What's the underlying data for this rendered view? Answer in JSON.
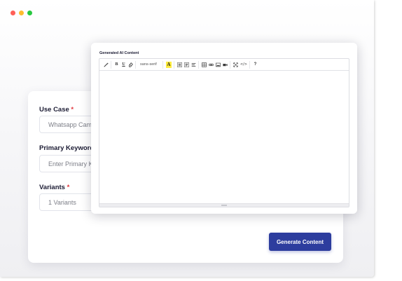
{
  "window": {
    "controls": [
      {
        "name": "close",
        "color": "#ff5f57"
      },
      {
        "name": "minimize",
        "color": "#febc2e"
      },
      {
        "name": "maximize",
        "color": "#28c840"
      }
    ]
  },
  "form": {
    "use_case": {
      "label": "Use Case",
      "required_mark": "*",
      "value": "Whatsapp Campaign"
    },
    "primary_keyword": {
      "label": "Primary Keyword",
      "placeholder": "Enter Primary Keyword"
    },
    "variants": {
      "label": "Variants",
      "required_mark": "*",
      "value": "1 Variants"
    },
    "generate_button": "Generate Content"
  },
  "editor": {
    "title": "Generated AI Content",
    "toolbar": {
      "magic_icon": "magic-wand-icon",
      "bold": "B",
      "underline": "U",
      "clear_icon": "eraser-icon",
      "font_family": "sans-serif",
      "color_letter": "A",
      "list_icons": [
        "unordered-list-icon",
        "ordered-list-icon",
        "align-icon"
      ],
      "insert_icons": [
        "table-icon",
        "link-icon",
        "image-icon",
        "video-icon"
      ],
      "view_icons": [
        "fullscreen-icon",
        "code-view-icon"
      ],
      "code_view": "</>",
      "help": "?"
    },
    "content": ""
  },
  "colors": {
    "accent": "#2d3d9e",
    "required": "#e0383e",
    "highlight": "#ffec3d"
  }
}
